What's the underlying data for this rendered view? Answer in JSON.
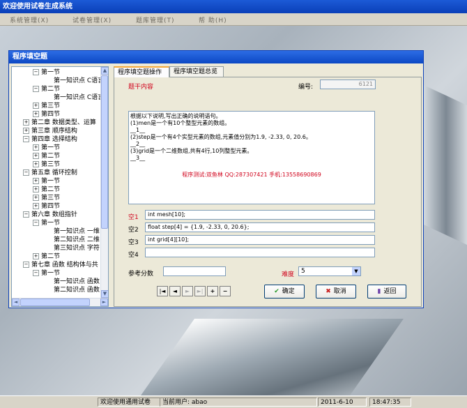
{
  "app": {
    "title": "欢迎使用试卷生成系统",
    "menu": [
      "系统管理(X)",
      "试卷管理(X)",
      "题库管理(T)",
      "帮 助(H)"
    ]
  },
  "dialog": {
    "title": "程序填空题",
    "tabs": [
      "程序填空题操作",
      "程序填空题总览"
    ],
    "tree": [
      {
        "label": "第一节",
        "level": 1,
        "state": "minus"
      },
      {
        "label": "第一知识点 C语言",
        "level": 2,
        "state": "none"
      },
      {
        "label": "第二节",
        "level": 1,
        "state": "minus"
      },
      {
        "label": "第一知识点 C语言",
        "level": 2,
        "state": "none"
      },
      {
        "label": "第三节",
        "level": 1,
        "state": "plus"
      },
      {
        "label": "第四节",
        "level": 1,
        "state": "plus"
      },
      {
        "label": "第二章 数据类型、运算",
        "level": 0,
        "state": "plus"
      },
      {
        "label": "第三章 顺序结构",
        "level": 0,
        "state": "plus"
      },
      {
        "label": "第四章 选择结构",
        "level": 0,
        "state": "minus"
      },
      {
        "label": "第一节",
        "level": 1,
        "state": "plus"
      },
      {
        "label": "第二节",
        "level": 1,
        "state": "plus"
      },
      {
        "label": "第三节",
        "level": 1,
        "state": "plus"
      },
      {
        "label": "第五章 循环控制",
        "level": 0,
        "state": "minus"
      },
      {
        "label": "第一节",
        "level": 1,
        "state": "plus"
      },
      {
        "label": "第二节",
        "level": 1,
        "state": "plus"
      },
      {
        "label": "第三节",
        "level": 1,
        "state": "plus"
      },
      {
        "label": "第四节",
        "level": 1,
        "state": "plus"
      },
      {
        "label": "第六章 数组指针",
        "level": 0,
        "state": "minus"
      },
      {
        "label": "第一节",
        "level": 1,
        "state": "minus"
      },
      {
        "label": "第一知识点 一维",
        "level": 2,
        "state": "none"
      },
      {
        "label": "第二知识点 二维",
        "level": 2,
        "state": "none"
      },
      {
        "label": "第三知识点 字符",
        "level": 2,
        "state": "none"
      },
      {
        "label": "第二节",
        "level": 1,
        "state": "plus"
      },
      {
        "label": "第七章 函数 结构体与共",
        "level": 0,
        "state": "minus"
      },
      {
        "label": "第一节",
        "level": 1,
        "state": "minus"
      },
      {
        "label": "第一知识点 函数",
        "level": 2,
        "state": "none"
      },
      {
        "label": "第二知识点 函数",
        "level": 2,
        "state": "none"
      }
    ],
    "form": {
      "stem_label": "题干内容",
      "number_label": "编号:",
      "number_value": "6121",
      "stem_lines": [
        "根据以下说明,写出正确的说明语句。",
        "(1)men是一个有10个整型元素的数组。",
        "__1__",
        "(2)step是一个有4个实型元素的数组,元素值分别为1.9, -2.33, 0, 20.6。",
        "__2__",
        "(3)grid是一个二维数组,共有4行,10列整型元素。",
        "__3__"
      ],
      "promo": "程序测试:双鱼林 QQ:287307421 手机:13558690869",
      "blanks": [
        {
          "label": "空1",
          "value": "int mesh[10];"
        },
        {
          "label": "空2",
          "value": "float step[4] = {1.9, -2.33, 0, 20.6};"
        },
        {
          "label": "空3",
          "value": "int grid[4][10];"
        },
        {
          "label": "空4",
          "value": ""
        }
      ],
      "score_label": "参考分数",
      "score_value": "",
      "difficulty_label": "难度",
      "difficulty_value": "5"
    },
    "nav_buttons": [
      "|◄",
      "◄",
      "►",
      "►|",
      "+",
      "−"
    ],
    "buttons": {
      "ok": "确定",
      "cancel": "取消",
      "back": "返回"
    }
  },
  "status": {
    "welcome": "欢迎使用通用试卷",
    "user": "当前用户: abao",
    "date": "2011-6-10",
    "time": "18:47:35"
  },
  "colors": {
    "accent_red": "#d0021b",
    "title_blue": "#0a3fb8"
  }
}
